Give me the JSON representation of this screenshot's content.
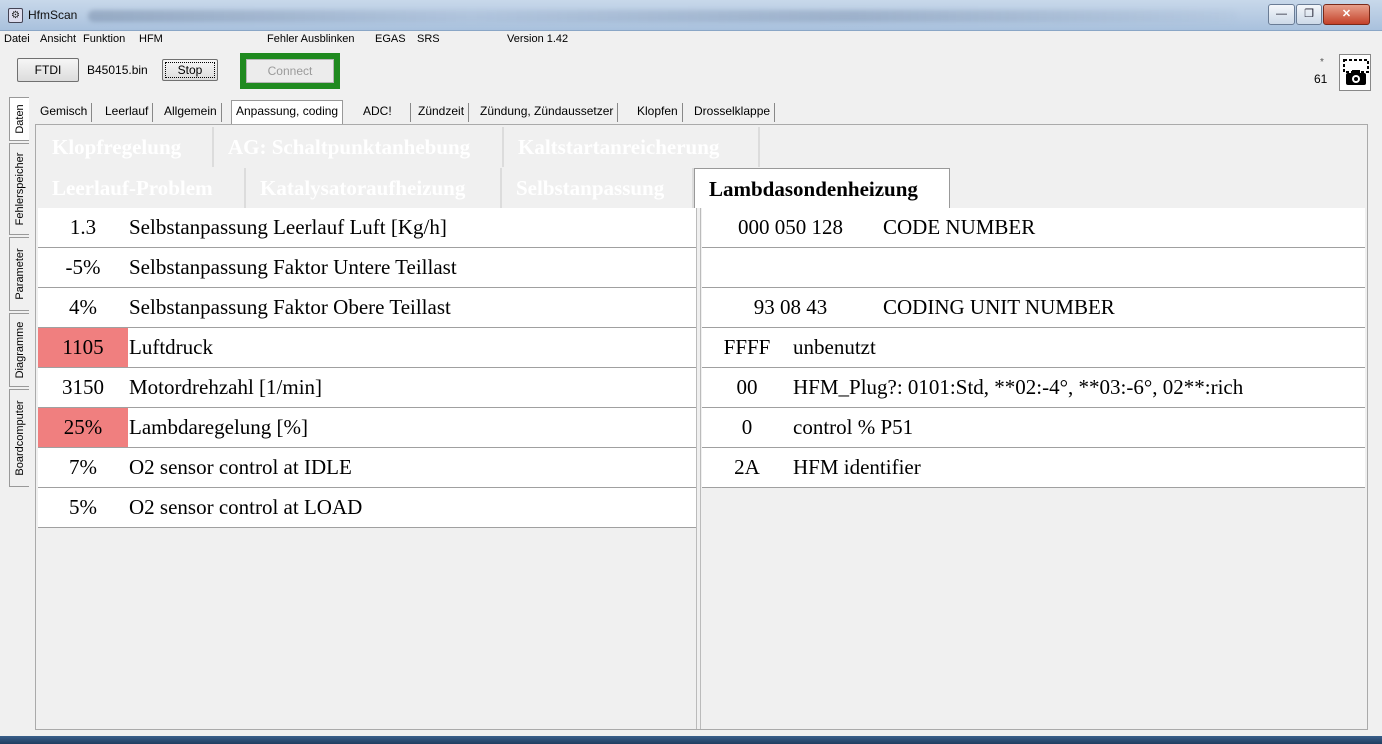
{
  "window": {
    "title": "HfmScan",
    "icon": "app-icon"
  },
  "menu": [
    "Datei",
    "Ansicht",
    "Funktion",
    "HFM",
    "Fehler Ausblinken",
    "EGAS",
    "SRS",
    "Version 1.42"
  ],
  "toolbar": {
    "ftdi": "FTDI",
    "file": "B45015.bin",
    "stop": "Stop",
    "connect": "Connect",
    "star": "*",
    "counter": "61",
    "connect_frame_color": "#1f8a1f"
  },
  "vtabs": [
    "Daten",
    "Fehlerspeicher",
    "Parameter",
    "Diagramme",
    "Boardcomputer"
  ],
  "tabs": [
    "Gemisch",
    "Leerlauf",
    "Allgemein",
    "Anpassung, coding",
    "ADC!",
    "Zündzeit",
    "Zündung, Zündaussetzer",
    "Klopfen",
    "Drosselklappe"
  ],
  "subtabs_row1": [
    "Klopfregelung",
    "AG: Schaltpunktanhebung",
    "Kaltstartanreicherung"
  ],
  "subtabs_row2": [
    "Leerlauf-Problem",
    "Katalysatoraufheizung",
    "Selbstanpassung",
    "Lambdasondenheizung"
  ],
  "left_rows": [
    {
      "value": "1.3",
      "label": "Selbstanpassung Leerlauf Luft [Kg/h]"
    },
    {
      "value": "-5%",
      "label": "Selbstanpassung Faktor Untere Teillast"
    },
    {
      "value": "4%",
      "label": "Selbstanpassung Faktor Obere Teillast"
    },
    {
      "value": "1105",
      "label": "Luftdruck"
    },
    {
      "value": "3150",
      "label": "Motordrehzahl [1/min]"
    },
    {
      "value": "25%",
      "label": "Lambdaregelung [%]"
    },
    {
      "value": "7%",
      "label": "O2 sensor control at IDLE"
    },
    {
      "value": "5%",
      "label": "O2 sensor control at LOAD"
    }
  ],
  "right_rows": [
    {
      "value": "000 050 128",
      "label": "CODE NUMBER"
    },
    {
      "value": "",
      "label": ""
    },
    {
      "value": "93 08 43",
      "label": "CODING UNIT NUMBER"
    },
    {
      "value": "FFFF",
      "label": "unbenutzt"
    },
    {
      "value": "00",
      "label": "HFM_Plug?: 0101:Std, **02:-4°, **03:-6°, 02**:rich"
    },
    {
      "value": "0",
      "label": "control % P51"
    },
    {
      "value": "2A",
      "label": "HFM identifier"
    }
  ],
  "highlight_color": "#f07f7f"
}
